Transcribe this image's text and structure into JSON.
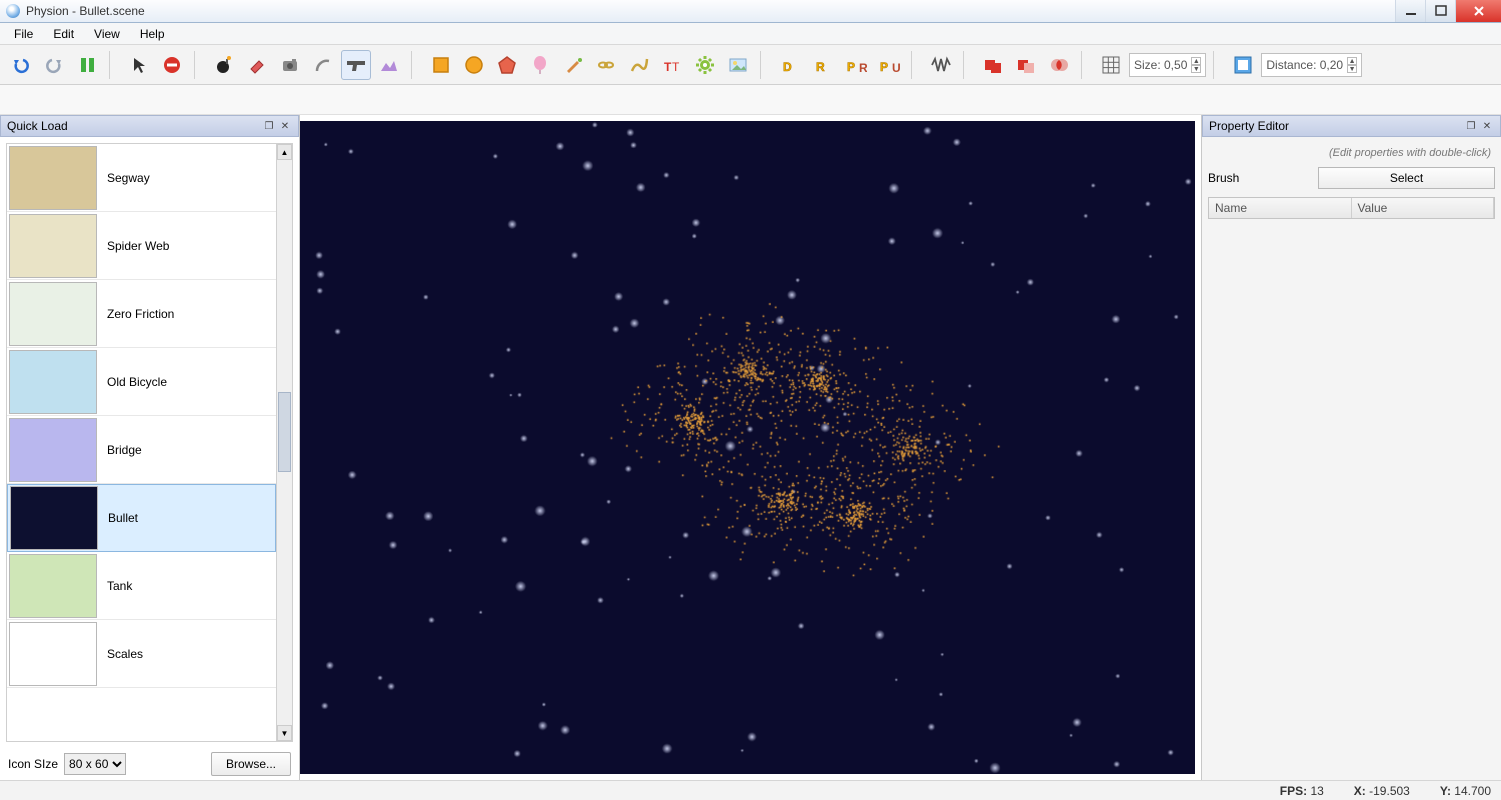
{
  "window": {
    "title": "Physion - Bullet.scene"
  },
  "menu": {
    "file": "File",
    "edit": "Edit",
    "view": "View",
    "help": "Help"
  },
  "toolbar": {
    "size_label": "Size: 0,50",
    "distance_label": "Distance: 0,20"
  },
  "quickload": {
    "title": "Quick Load",
    "items": [
      {
        "label": "Segway"
      },
      {
        "label": "Spider Web"
      },
      {
        "label": "Zero Friction"
      },
      {
        "label": "Old Bicycle"
      },
      {
        "label": "Bridge"
      },
      {
        "label": "Bullet",
        "selected": true
      },
      {
        "label": "Tank"
      },
      {
        "label": "Scales"
      }
    ],
    "icon_size_label": "Icon SIze",
    "icon_size_value": "80 x 60",
    "browse_label": "Browse..."
  },
  "property_editor": {
    "title": "Property Editor",
    "hint": "(Edit properties with double-click)",
    "brush_label": "Brush",
    "select_label": "Select",
    "col_name": "Name",
    "col_value": "Value"
  },
  "status": {
    "fps_label": "FPS:",
    "fps_value": "13",
    "x_label": "X:",
    "x_value": "-19.503",
    "y_label": "Y:",
    "y_value": "14.700"
  },
  "thumb_colors": [
    "#d8c79a",
    "#e9e3c6",
    "#e9f1e6",
    "#bfe0ef",
    "#b9b7ee",
    "#0d1030",
    "#cfe6b7",
    "#ffffff"
  ]
}
